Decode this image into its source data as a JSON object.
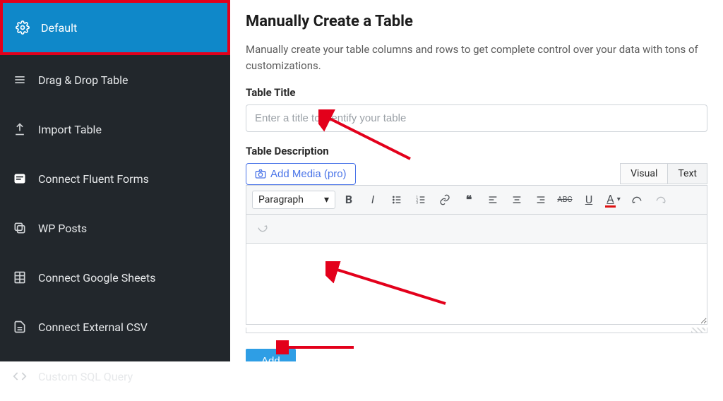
{
  "sidebar": {
    "items": [
      {
        "label": "Default",
        "active": true
      },
      {
        "label": "Drag & Drop Table"
      },
      {
        "label": "Import Table"
      },
      {
        "label": "Connect Fluent Forms"
      },
      {
        "label": "WP Posts"
      },
      {
        "label": "Connect Google Sheets"
      },
      {
        "label": "Connect External CSV"
      },
      {
        "label": "Custom SQL Query"
      }
    ]
  },
  "main": {
    "heading": "Manually Create a Table",
    "description": "Manually create your table columns and rows to get complete control over your data with tons of customizations.",
    "title_label": "Table Title",
    "title_placeholder": "Enter a title to identify your table",
    "desc_label": "Table Description",
    "add_media_label": "Add Media (pro)",
    "tabs": {
      "visual": "Visual",
      "text": "Text"
    },
    "paragraph_label": "Paragraph",
    "editor_value": "",
    "add_button": "Add"
  }
}
